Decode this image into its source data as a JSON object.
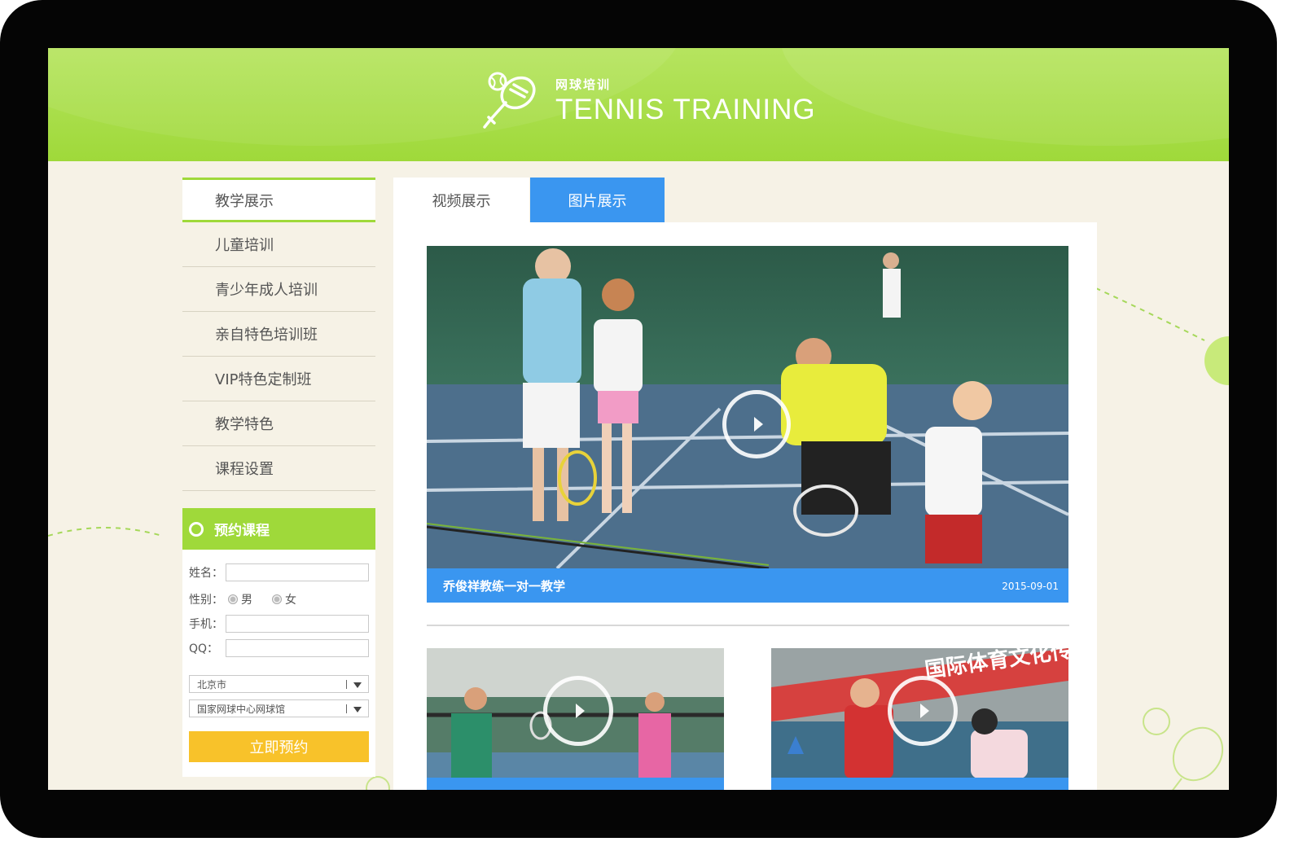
{
  "brand": {
    "name_cn": "网球培训",
    "name_en": "TENNIS TRAINING",
    "accent": "#9fd93a",
    "blue": "#3a96f0",
    "yellow": "#f8c22a"
  },
  "sidebar": {
    "items": [
      {
        "label": "教学展示",
        "active": true
      },
      {
        "label": "儿童培训"
      },
      {
        "label": "青少年成人培训"
      },
      {
        "label": "亲自特色培训班"
      },
      {
        "label": "VIP特色定制班"
      },
      {
        "label": "教学特色"
      },
      {
        "label": "课程设置"
      }
    ]
  },
  "booking": {
    "title": "预约课程",
    "name_label": "姓名：",
    "gender_label": "性别：",
    "gender_male": "男",
    "gender_female": "女",
    "phone_label": "手机：",
    "qq_label": "QQ：",
    "city": "北京市",
    "venue": "国家网球中心网球馆",
    "submit": "立即预约"
  },
  "tabs": [
    {
      "label": "视频展示"
    },
    {
      "label": "图片展示",
      "active": true
    }
  ],
  "featured": {
    "title": "乔俊祥教练一对一教学",
    "date": "2015-09-01",
    "icon": "play-icon"
  },
  "thumbnails": [
    {
      "icon": "play-icon"
    },
    {
      "icon": "play-icon",
      "banner_text": "国际体育文化传播有限公"
    }
  ]
}
